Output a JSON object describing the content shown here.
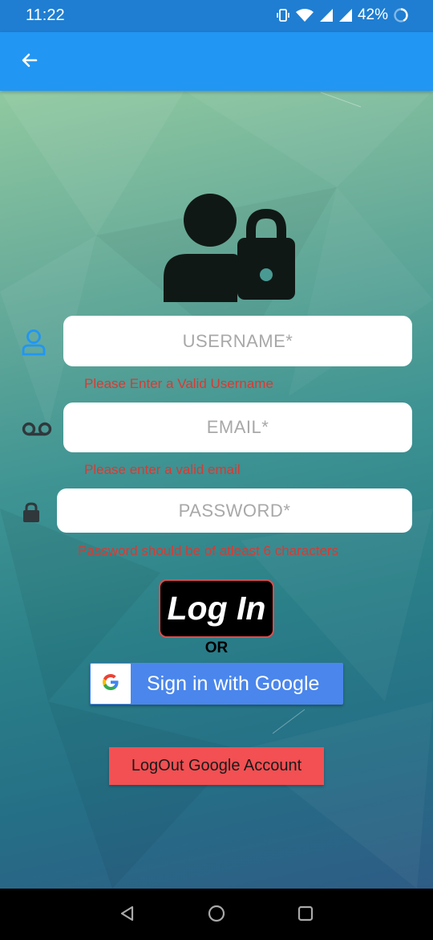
{
  "status_bar": {
    "time": "11:22",
    "battery_percent": "42%",
    "icons": [
      "vibrate-icon",
      "wifi-icon",
      "signal-icon",
      "signal-icon",
      "battery-icon"
    ]
  },
  "app_bar": {
    "back_icon": "arrow-left-icon",
    "color": "#2196f3"
  },
  "form": {
    "username": {
      "placeholder": "USERNAME*",
      "value": "",
      "icon": "person-outline-icon",
      "error": "Please Enter a Valid Username"
    },
    "email": {
      "placeholder": "EMAIL*",
      "value": "",
      "icon": "voicemail-icon",
      "error": "Please enter a valid email"
    },
    "password": {
      "placeholder": "PASSWORD*",
      "value": "",
      "icon": "lock-icon",
      "error": "Password should be of atleast 6 characters"
    }
  },
  "login_button": {
    "label": "Log In"
  },
  "or_text": "OR",
  "google_button": {
    "label": "Sign in with Google",
    "icon": "google-g-icon",
    "color": "#4a86ec"
  },
  "logout_button": {
    "label": "LogOut Google Account",
    "color": "#f25053"
  },
  "nav_bar": {
    "icons": [
      "back-triangle-icon",
      "home-circle-icon",
      "recents-square-icon"
    ]
  },
  "colors": {
    "error": "#d93a33",
    "accent": "#2196f3"
  }
}
